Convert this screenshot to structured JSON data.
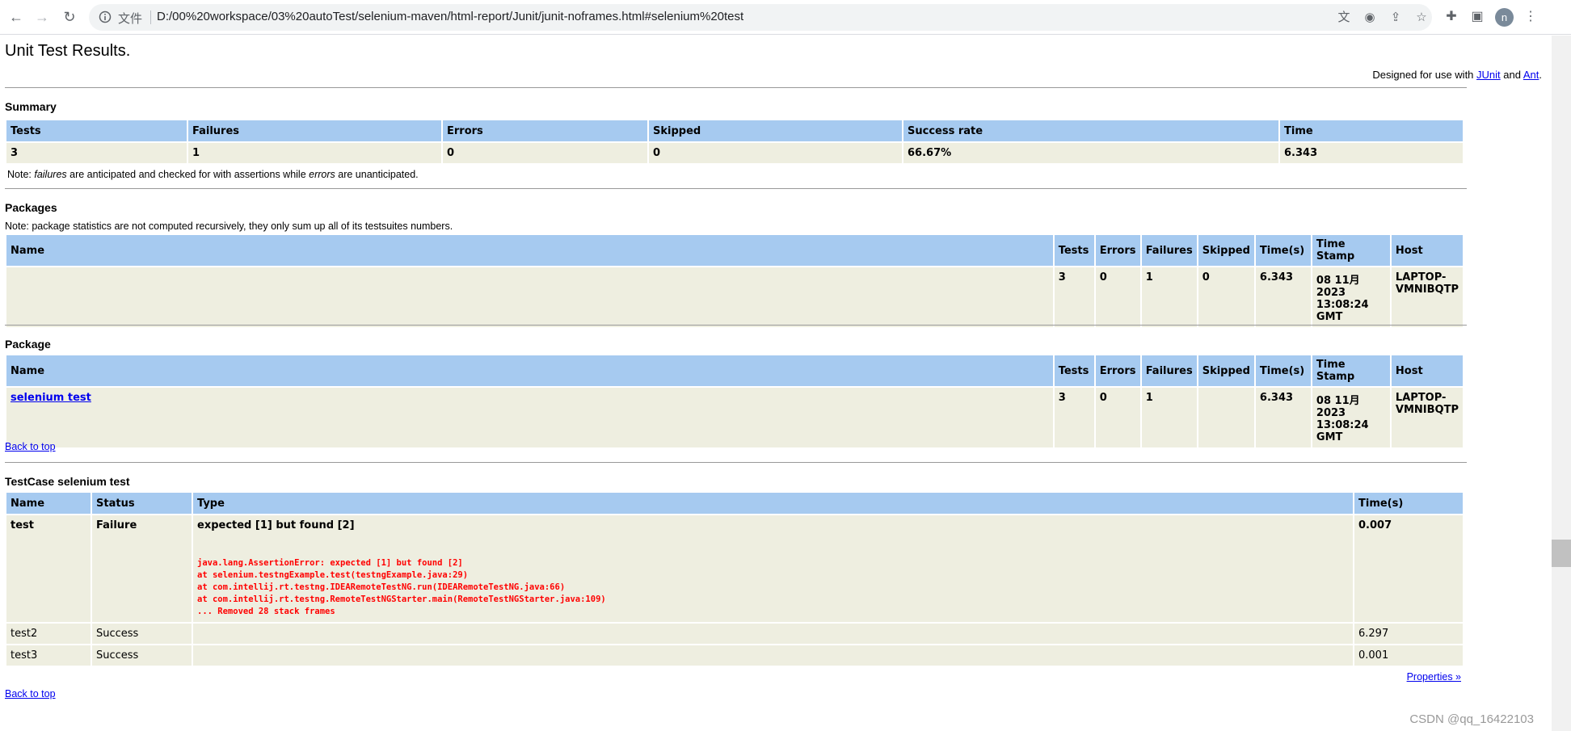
{
  "browser": {
    "file_label": "文件",
    "url": "D:/00%20workspace/03%20autoTest/selenium-maven/html-report/Junit/junit-noframes.html#selenium%20test",
    "avatar_letter": "n"
  },
  "header": {
    "title": "Unit Test Results.",
    "designed_prefix": "Designed for use with ",
    "junit_link": "JUnit",
    "designed_and": " and ",
    "ant_link": "Ant",
    "designed_suffix": "."
  },
  "summary": {
    "heading": "Summary",
    "columns": [
      "Tests",
      "Failures",
      "Errors",
      "Skipped",
      "Success rate",
      "Time"
    ],
    "row": [
      "3",
      "1",
      "0",
      "0",
      "66.67%",
      "6.343"
    ],
    "note_prefix": "Note: ",
    "note_failures": "failures",
    "note_mid": " are anticipated and checked for with assertions while ",
    "note_errors": "errors",
    "note_suffix": " are unanticipated."
  },
  "packages": {
    "heading": "Packages",
    "note": "Note: package statistics are not computed recursively, they only sum up all of its testsuites numbers.",
    "columns": [
      "Name",
      "Tests",
      "Errors",
      "Failures",
      "Skipped",
      "Time(s)",
      "Time Stamp",
      "Host"
    ],
    "row": [
      "",
      "3",
      "0",
      "1",
      "0",
      "6.343",
      "08 11月 2023 13:08:24 GMT",
      "LAPTOP-VMNIBQTP"
    ]
  },
  "package": {
    "heading": "Package",
    "columns": [
      "Name",
      "Tests",
      "Errors",
      "Failures",
      "Skipped",
      "Time(s)",
      "Time Stamp",
      "Host"
    ],
    "row": [
      "selenium test",
      "3",
      "0",
      "1",
      "",
      "6.343",
      "08 11月 2023 13:08:24 GMT",
      "LAPTOP-VMNIBQTP"
    ],
    "back_to_top": "Back to top"
  },
  "testcase": {
    "heading": "TestCase selenium test",
    "columns": [
      "Name",
      "Status",
      "Type",
      "Time(s)"
    ],
    "rows": [
      {
        "name": "test",
        "status": "Failure",
        "type": "expected [1] but found [2]",
        "time": "0.007",
        "trace": [
          "java.lang.AssertionError: expected [1] but found [2]",
          "at selenium.testngExample.test(testngExample.java:29)",
          "at com.intellij.rt.testng.IDEARemoteTestNG.run(IDEARemoteTestNG.java:66)",
          "at com.intellij.rt.testng.RemoteTestNGStarter.main(RemoteTestNGStarter.java:109)",
          "... Removed 28 stack frames"
        ]
      },
      {
        "name": "test2",
        "status": "Success",
        "type": "",
        "time": "6.297"
      },
      {
        "name": "test3",
        "status": "Success",
        "type": "",
        "time": "0.001"
      }
    ],
    "properties_link": "Properties »",
    "back_to_top": "Back to top"
  },
  "watermark": "CSDN @qq_16422103"
}
